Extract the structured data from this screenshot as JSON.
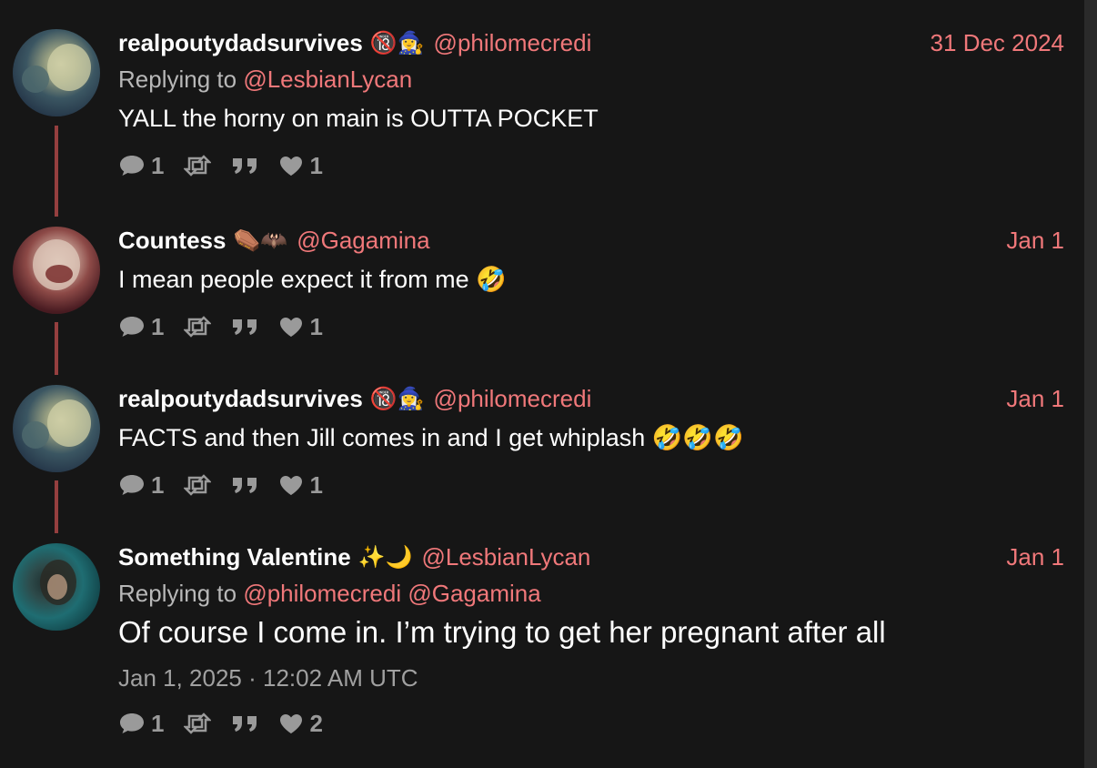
{
  "tweets": [
    {
      "name": "realpoutydadsurvives",
      "emoji": "🔞🧙‍♀️",
      "handle": "@philomecredi",
      "date": "31 Dec 2024",
      "replying_label": "Replying to",
      "replying_to": "@LesbianLycan",
      "text": "YALL the horny on main is OUTTA POCKET",
      "stats": {
        "replies": "1",
        "retweets": "",
        "quotes": "",
        "likes": "1"
      }
    },
    {
      "name": "Countess",
      "emoji": "⚰️🦇",
      "handle": "@Gagamina",
      "date": "Jan 1",
      "text": "I mean people expect it from me 🤣",
      "stats": {
        "replies": "1",
        "retweets": "",
        "quotes": "",
        "likes": "1"
      }
    },
    {
      "name": "realpoutydadsurvives",
      "emoji": "🔞🧙‍♀️",
      "handle": "@philomecredi",
      "date": "Jan 1",
      "text": "FACTS and then Jill comes in and I get whiplash 🤣🤣🤣",
      "stats": {
        "replies": "1",
        "retweets": "",
        "quotes": "",
        "likes": "1"
      }
    },
    {
      "name": "Something Valentine",
      "emoji": "✨🌙",
      "handle": "@LesbianLycan",
      "date": "Jan 1",
      "replying_label": "Replying to",
      "replying_to": "@philomecredi @Gagamina",
      "text": "Of course I come in. I’m trying to get her pregnant after all",
      "timestamp": "Jan 1, 2025 · 12:02 AM UTC",
      "stats": {
        "replies": "1",
        "retweets": "",
        "quotes": "",
        "likes": "2"
      }
    }
  ],
  "icons": {
    "reply": "comment-icon",
    "retweet": "retweet-icon",
    "quote": "quote-icon",
    "like": "heart-icon"
  },
  "colors": {
    "background": "#161616",
    "accent": "#f0787a",
    "thread_line": "#953f3f",
    "muted": "#9a9a9a"
  }
}
